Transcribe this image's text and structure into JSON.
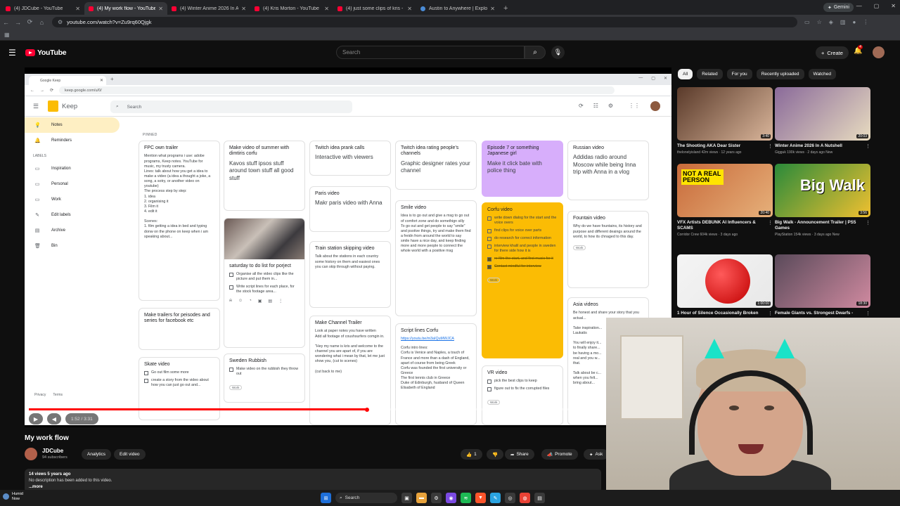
{
  "browser": {
    "tabs": [
      {
        "title": "(4) JDCube - YouTube",
        "icon": "youtube-icon",
        "active": false
      },
      {
        "title": "(4) My work flow - YouTube",
        "icon": "youtube-icon",
        "active": true
      },
      {
        "title": "(4) Winter Anime 2026 In A Nu",
        "icon": "youtube-icon",
        "active": false
      },
      {
        "title": "(4) Kris Morton - YouTube",
        "icon": "youtube-icon",
        "active": false
      },
      {
        "title": "(4) just some clips of kris - You",
        "icon": "youtube-icon",
        "active": false
      },
      {
        "title": "Austin to Anywhere | Explore",
        "icon": "globe-icon",
        "active": false
      }
    ],
    "gemini_label": "Gemini",
    "url": "youtube.com/watch?v=Zu9rq60Qjgk"
  },
  "youtube": {
    "logo_text": "YouTube",
    "search_placeholder": "Search",
    "create_label": "Create",
    "notif_count": "4"
  },
  "video": {
    "title": "My work flow",
    "channel": "JDCube",
    "subscribers": "94 subscribers",
    "time": "1:52 / 3:31",
    "progress": 0.53,
    "likes": "1",
    "buttons": {
      "analytics": "Analytics",
      "edit": "Edit video",
      "share": "Share",
      "promote": "Promote",
      "ask": "Ask"
    },
    "views_date": "14 views  5 years ago",
    "description": "No description has been added to this video.",
    "more": "...more"
  },
  "keep": {
    "tab_title": "Google Keep",
    "url": "keep.google.com/u/0/",
    "app_name": "Keep",
    "search_placeholder": "Search",
    "nav": [
      {
        "label": "Notes",
        "icon": "bulb-icon",
        "active": true
      },
      {
        "label": "Reminders",
        "icon": "bell-icon",
        "active": false
      }
    ],
    "labels_heading": "LABELS",
    "label_items": [
      {
        "label": "Inspiration",
        "icon": "label-icon"
      },
      {
        "label": "Personal",
        "icon": "label-icon"
      },
      {
        "label": "Work",
        "icon": "label-icon"
      },
      {
        "label": "Edit labels",
        "icon": "pencil-icon"
      },
      {
        "label": "Archive",
        "icon": "archive-icon"
      },
      {
        "label": "Bin",
        "icon": "trash-icon"
      }
    ],
    "footer": {
      "privacy": "Privacy",
      "terms": "Terms",
      "licenses": "Open-source licences"
    },
    "pinned_label": "PINNED",
    "notes": {
      "fpc": {
        "title": "FPC own trailer",
        "body": "Mention what programs i use: adobe programs, Keep notes. YouTube for music, my trusty camera.\nLines: talk about how you get a idea to make a video (a idea a thought a joke, a song, a sotry, or another video on youtube)\nThe process step by step:\n1. idea\n2. organising it\n3. Film it\n4. edit it\n\nScenes:\n1. film getting a idea in bed and typing donw on the phone on keep when i am speaking about..."
      },
      "trailers": {
        "title": "Make trailers for peisodes and series for facebook etc"
      },
      "skate": {
        "title": "Skate video",
        "items": [
          "Go out film some more",
          "create a story from the video about how you can just go out and..."
        ]
      },
      "summer": {
        "title": "Make video of summer with dimtiris corfu",
        "body": "Kavos stuff ipsos stuff around town stuff all good stuff"
      },
      "saturday": {
        "title": "saturday to do list for porject",
        "items": [
          "Organise all the video clips like the picture and put them in...",
          "Write script lines for each place, for the stock footage area..."
        ]
      },
      "sweden": {
        "title": "Sweden Rubbish",
        "items": [
          "Make video on the rubbish they throw out"
        ],
        "chip": "Work"
      },
      "twitch_prank": {
        "title": "Twitch idea prank calls",
        "body": "Interactive with viewers"
      },
      "paris": {
        "title": "Paris video",
        "body": "Makr paris video with Anna"
      },
      "train": {
        "title": "Train station skipping video",
        "body": "Talk about the stations in each country some history on them and easiest ones you can skip through without paying."
      },
      "channel_trailer": {
        "title": "Make Channel Trailer",
        "body": "Look at paper notes you have written\nAdd all footage of coushsurfers comgin in.\n\n\"Hey my name is kris and welcome to the channel you are apart of, if you are wondering what i mean by that, let me just show you, (cut to scenes)\n\n(cut back to me)"
      },
      "twitch_rating": {
        "title": "Twitch idea rating people's channels",
        "body": "Graphic designer rates your channel"
      },
      "smile": {
        "title": "Smile video",
        "body": "Idea is to go out and give a msg to go out of comfort zone and do somethign silly\nTo go out and get people to say \"smile\" and psotive things, try and make them find a freidn from around the world to say smile have a nice day, and keep finding more and more people to connect the whole world with a positive msg"
      },
      "script_corfu": {
        "title": "Script lines Corfu",
        "link": "https://youtu.be/m3aIQuMWJCA",
        "body": "Corfu intro lines:\nCorfu is Venice and Naples, a touch of France and more than a dash of England, apart of course from being Greek\nCorfu was founded the first university or Greece\nThe first tennis club in Greece\nDuke of Edinburgh, husband of Queen Elisabeth of England"
      },
      "episode7": {
        "title": "Episode 7 or something Japanese girl",
        "body": "Make it click bate with police thing"
      },
      "corfu": {
        "title": "Corfu video",
        "items": [
          {
            "text": "write down dialog for the start and the voice overs",
            "done": false
          },
          {
            "text": "find clips for voice over parts",
            "done": false
          },
          {
            "text": "do research for correct information",
            "done": false
          },
          {
            "text": "interview khalil and people in sweden for there side how it is",
            "done": false
          },
          {
            "text": "re film the start, and first music for it",
            "done": true
          },
          {
            "text": "Contact mindful for interview",
            "done": true
          }
        ],
        "chip": "Work"
      },
      "vr": {
        "title": "VR video",
        "items": [
          "pick the best clips to keep",
          "figure out to fix the corrupted files"
        ],
        "chip": "Work"
      },
      "russian": {
        "title": "Russian video",
        "body": "Addidas radio around Moscow while being Inna trip with Anna in a vlog"
      },
      "fountain": {
        "title": "Fountain video",
        "body": "Why do we have fountains, its history and purpose and different deaings around the world, to how its chnaged to this day.",
        "chip": "Work"
      },
      "asia": {
        "title": "Asia videos",
        "body": "Be honest and share your story that you actual...\n\nTake inspiration...\nLaukatis\n\nYou will enjoy it...\nto finally share...\nbe having a mo...\nreal and you w...\nthat.\n\nTalk about be c...\nwhen you felt...\nbring about..."
      }
    }
  },
  "sidebar": {
    "chips": [
      "All",
      "Related",
      "For you",
      "Recently uploaded",
      "Watched"
    ],
    "videos": [
      {
        "title": "The Shooting AKA Dear Sister",
        "meta": "thelonelyisland  42m views · 12 years ago",
        "duration": "3:40",
        "colors": [
          "#5a3a2a",
          "#d9b59a"
        ]
      },
      {
        "title": "Winter Anime 2026 In A Nutshell",
        "meta": "Gigguk  190k views · 2 days ago  New",
        "duration": "20:03",
        "colors": [
          "#8a6a9a",
          "#e8dcc0"
        ]
      },
      {
        "title": "VFX Artists DEBUNK AI Influencers & SCAMS",
        "meta": "Corridor Crew  604k views · 3 days ago",
        "duration": "20:40",
        "overlay": "NOT A REAL PERSON",
        "colors": [
          "#c86a3a",
          "#e6b07a"
        ]
      },
      {
        "title": "Big Walk - Announcement Trailer | PS5 Games",
        "meta": "PlayStation  154k views · 3 days ago  New",
        "duration": "3:56",
        "overlay": "Big Walk",
        "colors": [
          "#2a8a3a",
          "#f0c030"
        ]
      },
      {
        "title": "1 Hour of Silence Occasionally Broken",
        "meta": "",
        "duration": "1:00:00",
        "colors": [
          "#f4f4f4",
          "#e8e8e8"
        ]
      },
      {
        "title": "Female Giants vs. Strongest Dwarfs -",
        "meta": "",
        "duration": "18:30",
        "colors": [
          "#5a4a5a",
          "#d08aa0"
        ]
      }
    ]
  },
  "taskbar": {
    "weather": "Humid",
    "weather_sub": "Now",
    "search": "Search"
  }
}
